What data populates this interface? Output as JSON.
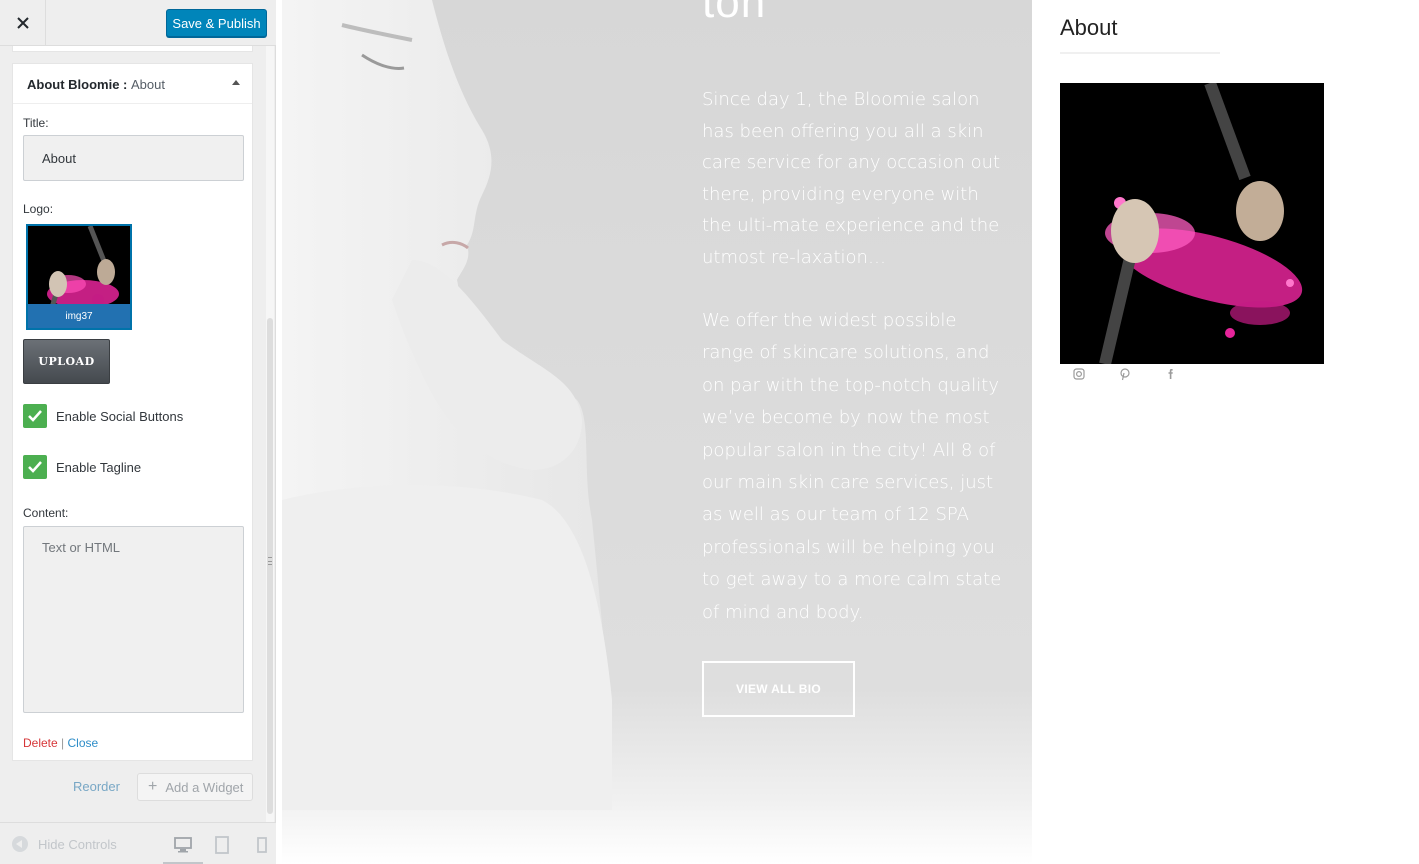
{
  "header": {
    "close_icon": "close-icon",
    "save_label": "Save & Publish"
  },
  "widget": {
    "title_bold": "About Bloomie :",
    "title_sub": "About",
    "title_label": "Title:",
    "title_value": "About",
    "logo_label": "Logo:",
    "logo_filename": "img37",
    "upload_label": "UPLOAD",
    "social_label": "Enable Social Buttons",
    "social_checked": true,
    "tagline_label": "Enable Tagline",
    "tagline_checked": true,
    "content_label": "Content:",
    "content_placeholder": "Text or HTML",
    "delete_label": "Delete",
    "separator": "|",
    "close_label": "Close"
  },
  "footer_actions": {
    "reorder_label": "Reorder",
    "add_widget_label": "Add a Widget"
  },
  "sb_footer": {
    "hide_controls_label": "Hide Controls",
    "devices": [
      "desktop-icon",
      "tablet-icon",
      "mobile-icon"
    ]
  },
  "preview": {
    "heading_fragment": "ton",
    "paragraph1": "Since day 1, the Bloomie salon has been offering you all a skin care service for any occasion out there, providing everyone with the ulti-mate experience and the utmost re-laxation…",
    "paragraph2": "We offer the widest possible range of skincare solutions, and on par with the top-notch quality we’ve become by now the most popular salon in the city! All 8 of our main skin care services, just as well as our team of 12 SPA professionals will be helping you to get away to a more calm state of mind and body.",
    "view_bio_label": "VIEW ALL BIO",
    "about_title": "About",
    "social_icons": [
      "instagram-icon",
      "pinterest-icon",
      "facebook-icon"
    ]
  },
  "colors": {
    "primary": "#0085ba",
    "checkbox": "#4caf50",
    "delete": "#d63638",
    "link": "#2e8dc8",
    "accent_pink": "#e6249a"
  }
}
